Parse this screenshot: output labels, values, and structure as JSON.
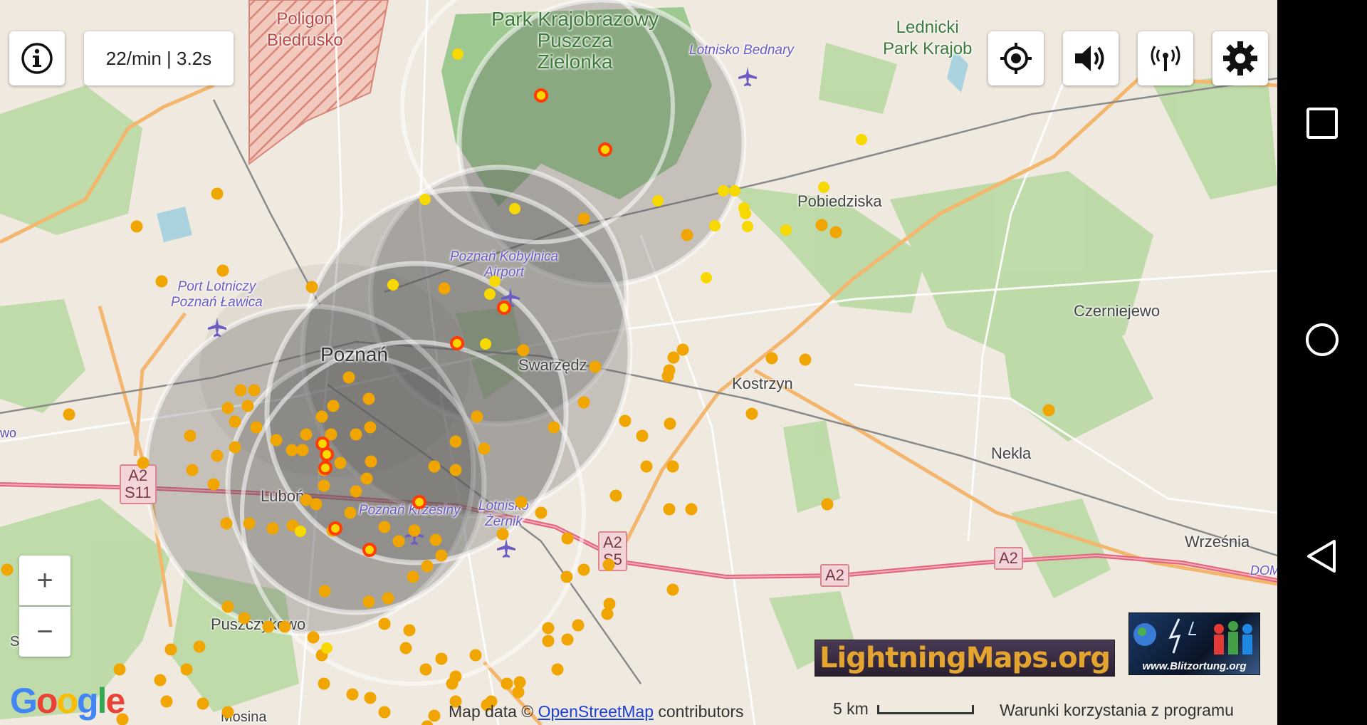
{
  "status": {
    "rate_text": "22/min | 3.2s"
  },
  "places": {
    "poligon": "Poligon\nBiedrusko",
    "park_puszcza": "Park Krajobrazowy\nPuszcza\nZielonka",
    "lednicki": "Lednicki\nPark Krajob",
    "lotnisko_bednary": "Lotnisko Bednary",
    "pobiedziska": "Pobiedziska",
    "port_lawica": "Port Lotniczy\nPoznań Ławica",
    "kobylnica": "Poznań Kobylnica\nAirport",
    "poznan": "Poznań",
    "swarzedz": "Swarzędz",
    "kostrzyn": "Kostrzyn",
    "czerniejewo": "Czerniejewo",
    "nekla": "Nekla",
    "lubon": "Luboń",
    "krzesiny": "Poznań Krzesiny",
    "zernik": "Lotnisko\nŻernik",
    "puszczykowo": "Puszczykowo",
    "wrzesnia": "Września",
    "mosina": "Mosina",
    "edge_left": "wo",
    "edge_bottom_left": "S",
    "dom": "DOM"
  },
  "roads": {
    "a2_s11": "A2\nS11",
    "a2_s5": "A2\nS5",
    "a2_a": "A2",
    "a2_b": "A2"
  },
  "controls": {
    "info_icon": "info-icon",
    "locate_icon": "crosshair-icon",
    "sound_icon": "speaker-icon",
    "station_icon": "antenna-icon",
    "settings_icon": "gear-icon",
    "zoom_in": "+",
    "zoom_out": "−"
  },
  "branding": {
    "lightningmaps": "LightningMaps.org",
    "blitzortung": "www.Blitzortung.org",
    "google": "Google"
  },
  "attribution": {
    "prefix": "Map data ©",
    "osm_link": "OpenStreetMap",
    "suffix": "contributors",
    "scale": "5 km",
    "terms": "Warunki korzystania z programu"
  },
  "colors": {
    "strike_old": "#f0a500",
    "strike_recent": "#f7d900",
    "strike_new": "#ff3b00",
    "forest": "#b7d8a0",
    "motorway": "#e0667e"
  }
}
